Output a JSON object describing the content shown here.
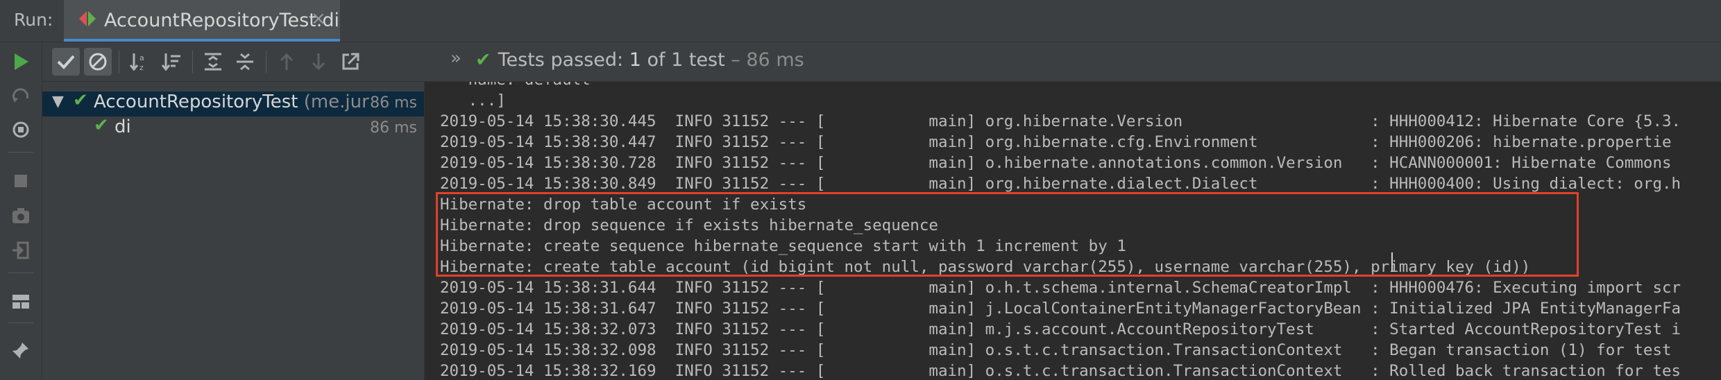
{
  "tabbar": {
    "run_label": "Run:",
    "tab_title": "AccountRepositoryTest.di",
    "close_glyph": "×"
  },
  "toolbar": {
    "buttons": [
      "rerun-icon",
      "show-passed-icon",
      "show-ignored-icon",
      "sort-alpha-icon",
      "sort-duration-icon",
      "expand-all-icon",
      "collapse-all-icon",
      "prev-failed-icon",
      "next-failed-icon",
      "export-icon"
    ],
    "more_glyph": "»",
    "status": {
      "prefix": "Tests passed:",
      "count": "1",
      "suffix": "of 1 test",
      "duration": "– 86 ms"
    }
  },
  "tree": {
    "items": [
      {
        "name": "AccountRepositoryTest",
        "package": "(me.jur",
        "time": "86 ms",
        "expanded": true,
        "selected": true
      },
      {
        "name": "di",
        "package": "",
        "time": "86 ms"
      }
    ]
  },
  "console": {
    "lines": [
      "   name: default",
      "   ...]",
      "2019-05-14 15:38:30.445  INFO 31152 --- [           main] org.hibernate.Version                    : HHH000412: Hibernate Core {5.3.",
      "2019-05-14 15:38:30.447  INFO 31152 --- [           main] org.hibernate.cfg.Environment            : HHH000206: hibernate.propertie",
      "2019-05-14 15:38:30.728  INFO 31152 --- [           main] o.hibernate.annotations.common.Version   : HCANN000001: Hibernate Commons",
      "2019-05-14 15:38:30.849  INFO 31152 --- [           main] org.hibernate.dialect.Dialect            : HHH000400: Using dialect: org.h",
      "Hibernate: drop table account if exists",
      "Hibernate: drop sequence if exists hibernate_sequence",
      "Hibernate: create sequence hibernate_sequence start with 1 increment by 1",
      "Hibernate: create table account (id bigint not null, password varchar(255), username varchar(255), primary key (id))",
      "2019-05-14 15:38:31.644  INFO 31152 --- [           main] o.h.t.schema.internal.SchemaCreatorImpl  : HHH000476: Executing import scr",
      "2019-05-14 15:38:31.647  INFO 31152 --- [           main] j.LocalContainerEntityManagerFactoryBean : Initialized JPA EntityManagerFa",
      "2019-05-14 15:38:32.073  INFO 31152 --- [           main] m.j.s.account.AccountRepositoryTest      : Started AccountRepositoryTest i",
      "2019-05-14 15:38:32.098  INFO 31152 --- [           main] o.s.t.c.transaction.TransactionContext   : Began transaction (1) for test",
      "2019-05-14 15:38:32.169  INFO 31152 --- [           main] o.s.t.c.transaction.TransactionContext   : Rolled back transaction for tes"
    ]
  },
  "colors": {
    "pass_green": "#5fb04c",
    "highlight_red": "#e0412a",
    "selection_blue": "#0d293e",
    "run_green": "#4ca84a"
  }
}
